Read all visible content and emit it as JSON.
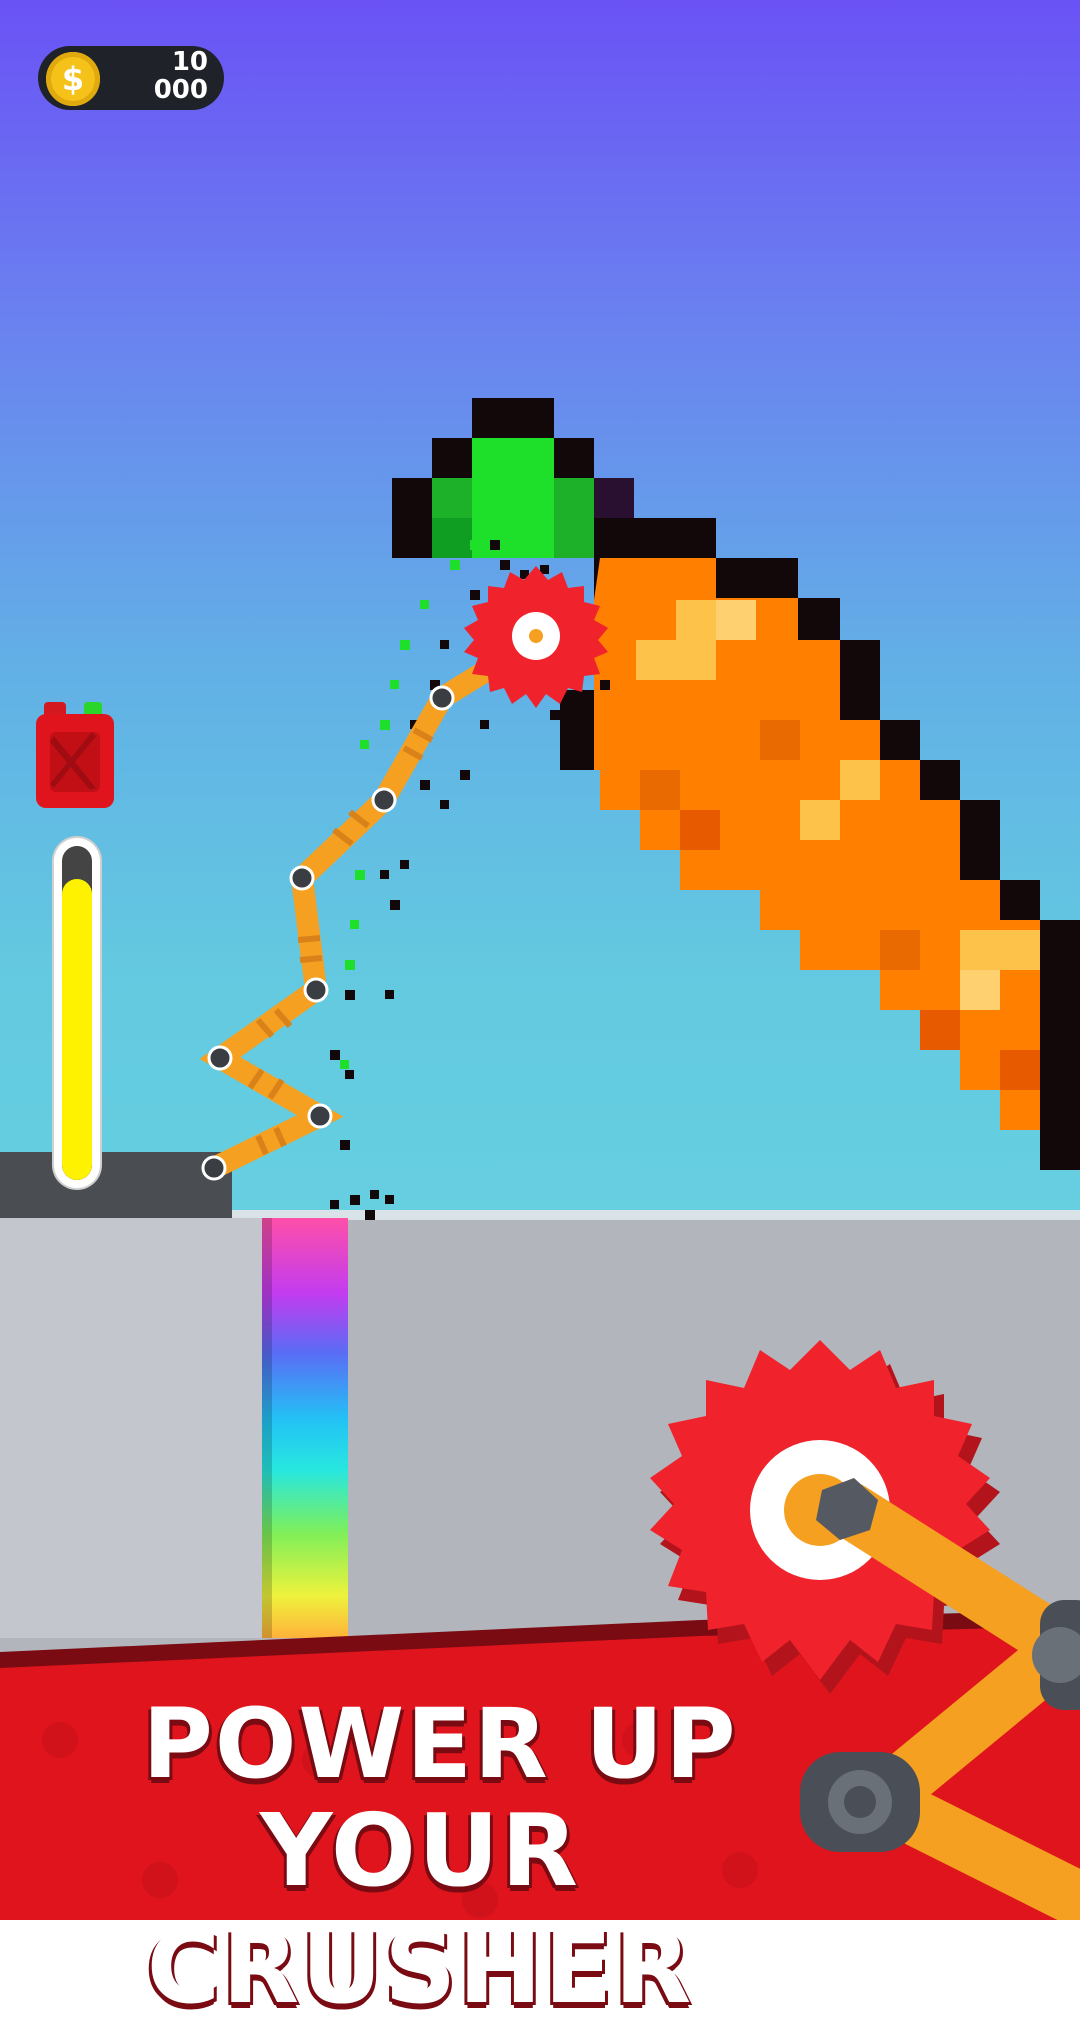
{
  "hud": {
    "coin_symbol": "$",
    "coin_amount": "10\n000",
    "fuel_level": 0.9
  },
  "banner": {
    "line1": "POWER UP",
    "line2": "YOUR CRUSHER"
  },
  "icons": [
    "coin-icon",
    "fuel-can-icon",
    "saw-blade-icon"
  ],
  "colors": {
    "banner_red": "#e0141c",
    "saw_red": "#f0222c",
    "arm_orange": "#f5a020",
    "carrot_orange": "#ff7f00",
    "leaf_green": "#1db12a",
    "gauge_yellow": "#fff200"
  }
}
